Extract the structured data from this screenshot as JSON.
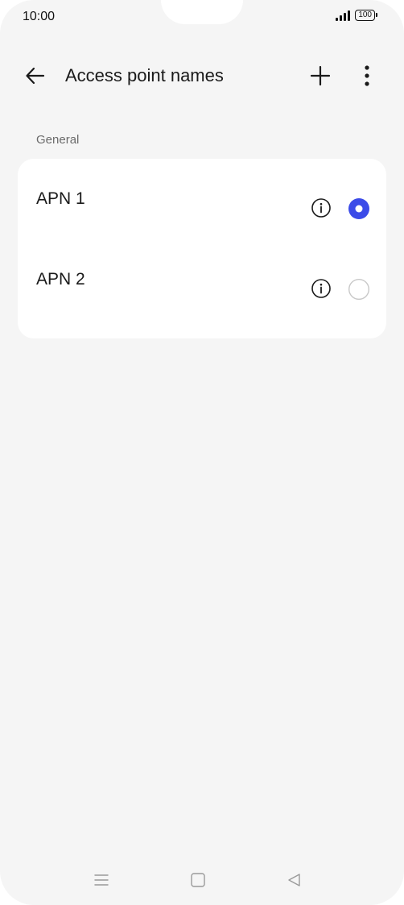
{
  "status_bar": {
    "time": "10:00",
    "battery": "100",
    "icons": [
      "signal-icon",
      "battery-icon"
    ]
  },
  "header": {
    "title": "Access point names",
    "icons": [
      "back-arrow-icon",
      "add-icon",
      "more-vertical-icon"
    ]
  },
  "section": {
    "label": "General"
  },
  "apns": [
    {
      "name": "APN 1",
      "selected": true
    },
    {
      "name": "APN 2",
      "selected": false
    }
  ],
  "colors": {
    "accent": "#3b4be8",
    "background": "#f5f5f5",
    "card": "#ffffff"
  },
  "nav_bar": {
    "icons": [
      "menu-icon",
      "home-icon",
      "back-triangle-icon"
    ]
  }
}
